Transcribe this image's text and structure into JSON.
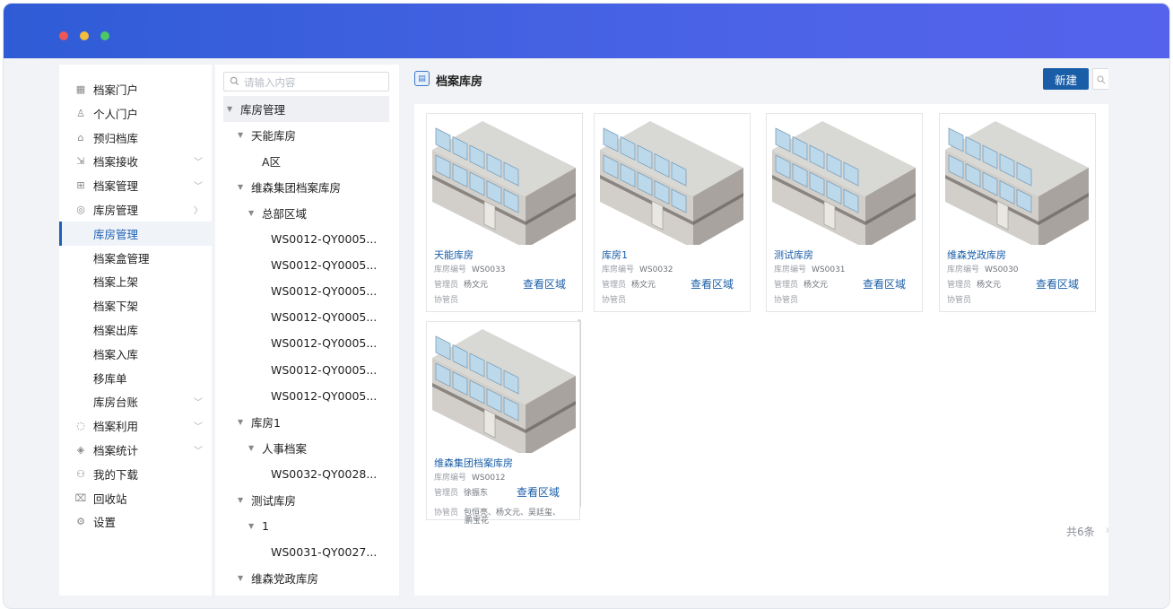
{
  "window": {
    "dots": [
      {
        "name": "close",
        "color": "#ef5656"
      },
      {
        "name": "minimize",
        "color": "#f5bd3b"
      },
      {
        "name": "maximize",
        "color": "#4cc868"
      }
    ]
  },
  "sidebar": {
    "items": [
      {
        "label": "档案门户",
        "icon": "grid-icon"
      },
      {
        "label": "个人门户",
        "icon": "user-icon"
      },
      {
        "label": "预归档库",
        "icon": "archive-icon"
      },
      {
        "label": "档案接收",
        "icon": "receive-icon",
        "arrow": "down"
      },
      {
        "label": "档案管理",
        "icon": "apps-icon",
        "arrow": "down"
      },
      {
        "label": "库房管理",
        "icon": "warehouse-icon",
        "arrow": "right"
      },
      {
        "label": "库房管理",
        "active": true
      },
      {
        "label": "档案盒管理"
      },
      {
        "label": "档案上架"
      },
      {
        "label": "档案下架"
      },
      {
        "label": "档案出库"
      },
      {
        "label": "档案入库"
      },
      {
        "label": "移库单"
      },
      {
        "label": "库房台账",
        "arrow": "down"
      },
      {
        "label": "档案利用",
        "icon": "use-icon",
        "arrow": "down"
      },
      {
        "label": "档案统计",
        "icon": "stats-icon",
        "arrow": "down"
      },
      {
        "label": "我的下载",
        "icon": "download-icon"
      },
      {
        "label": "回收站",
        "icon": "trash-icon"
      },
      {
        "label": "设置",
        "icon": "gear-icon"
      }
    ]
  },
  "tree": {
    "placeholder": "请输入内容",
    "nodes": [
      {
        "label": "库房管理",
        "level": 0,
        "expanded": true,
        "selected": true
      },
      {
        "label": "天能库房",
        "level": 1,
        "expanded": true
      },
      {
        "label": "A区",
        "level": 2
      },
      {
        "label": "维森集团档案库房",
        "level": 1,
        "expanded": true
      },
      {
        "label": "总部区域",
        "level": 2,
        "expanded": true
      },
      {
        "label": "WS0012-QY0005...",
        "level": 3
      },
      {
        "label": "WS0012-QY0005...",
        "level": 3
      },
      {
        "label": "WS0012-QY0005...",
        "level": 3
      },
      {
        "label": "WS0012-QY0005...",
        "level": 3
      },
      {
        "label": "WS0012-QY0005...",
        "level": 3
      },
      {
        "label": "WS0012-QY0005...",
        "level": 3
      },
      {
        "label": "WS0012-QY0005...",
        "level": 3
      },
      {
        "label": "库房1",
        "level": 1,
        "expanded": true
      },
      {
        "label": "人事档案",
        "level": 2,
        "expanded": true
      },
      {
        "label": "WS0032-QY0028...",
        "level": 3
      },
      {
        "label": "测试库房",
        "level": 1,
        "expanded": true
      },
      {
        "label": "1",
        "level": 2,
        "expanded": true
      },
      {
        "label": "WS0031-QY0027...",
        "level": 3
      },
      {
        "label": "维森党政库房",
        "level": 1,
        "expanded": true
      }
    ]
  },
  "main": {
    "title": "档案库房",
    "new_button": "新建",
    "total": "共6条",
    "close_mark": "×",
    "cards": [
      {
        "name": "天能库房",
        "code_label": "库房编号",
        "code": "WS0033",
        "manager_label": "管理员",
        "manager": "杨文元",
        "assistant_label": "协管员",
        "assistant": "",
        "link": "查看区域"
      },
      {
        "name": "库房1",
        "code_label": "库房编号",
        "code": "WS0032",
        "manager_label": "管理员",
        "manager": "杨文元",
        "assistant_label": "协管员",
        "assistant": "",
        "link": "查看区域"
      },
      {
        "name": "测试库房",
        "code_label": "库房编号",
        "code": "WS0031",
        "manager_label": "管理员",
        "manager": "杨文元",
        "assistant_label": "协管员",
        "assistant": "",
        "link": "查看区域"
      },
      {
        "name": "维森党政库房",
        "code_label": "库房编号",
        "code": "WS0030",
        "manager_label": "管理员",
        "manager": "杨文元",
        "assistant_label": "协管员",
        "assistant": "",
        "link": "查看区域"
      },
      {
        "name": "维森集团档案库房",
        "code_label": "库房编号",
        "code": "WS0012",
        "manager_label": "管理员",
        "manager": "徐振东",
        "assistant_label": "协管员",
        "assistant": "包恒亮、杨文元、吴廷玺、",
        "assistant2": "鹏宝花",
        "link": "查看区域"
      }
    ]
  }
}
